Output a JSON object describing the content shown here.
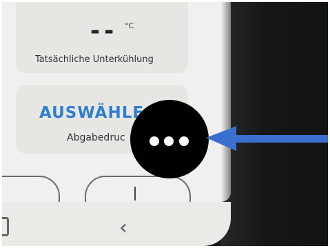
{
  "screen": {
    "temperature_value": "--",
    "temperature_unit": "°C",
    "temperature_label": "Tatsächliche Unterkühlung",
    "select_label": "AUSWÄHLE",
    "pressure_label": "Abgabedruc"
  },
  "overlay": {
    "menu_icon": "more-horizontal-icon",
    "arrow_icon": "arrow-left-icon",
    "arrow_color": "#3a6fd0"
  },
  "nav": {
    "back_icon": "‹",
    "recent_icon": "recent-apps-icon"
  }
}
